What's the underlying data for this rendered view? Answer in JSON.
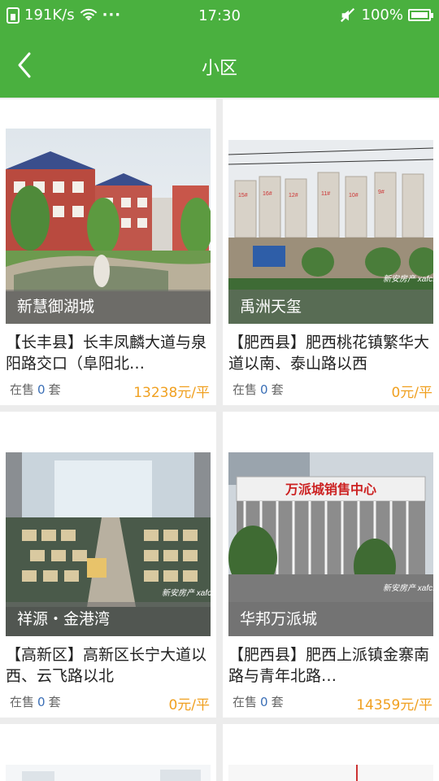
{
  "status_bar": {
    "speed": "191K/s",
    "more": "···",
    "time": "17:30",
    "battery": "100%"
  },
  "nav": {
    "title": "小区"
  },
  "listings": [
    {
      "name": "新慧御湖城",
      "address": "【长丰县】长丰凤麟大道与泉阳路交口（阜阳北…",
      "sale_label": "在售",
      "sale_count": "0",
      "sale_unit": "套",
      "price": "13238元/平"
    },
    {
      "name": "禹洲天玺",
      "address": "【肥西县】肥西桃花镇繁华大道以南、泰山路以西",
      "sale_label": "在售",
      "sale_count": "0",
      "sale_unit": "套",
      "price": "0元/平",
      "watermark": "新安房产 xafc.com"
    },
    {
      "name": "祥源・金港湾",
      "address": "【高新区】高新区长宁大道以西、云飞路以北",
      "sale_label": "在售",
      "sale_count": "0",
      "sale_unit": "套",
      "price": "0元/平",
      "watermark": "新安房产 xafc.com"
    },
    {
      "name": "华邦万派城",
      "address": "【肥西县】肥西上派镇金寨南路与青年北路…",
      "sale_label": "在售",
      "sale_count": "0",
      "sale_unit": "套",
      "price": "14359元/平",
      "watermark": "新安房产 xafc.com",
      "sign_text": "万派城销售中心"
    }
  ],
  "colors": {
    "brand_green": "#4ab03f",
    "price_orange": "#f0a020",
    "count_blue": "#3b6fb6"
  }
}
